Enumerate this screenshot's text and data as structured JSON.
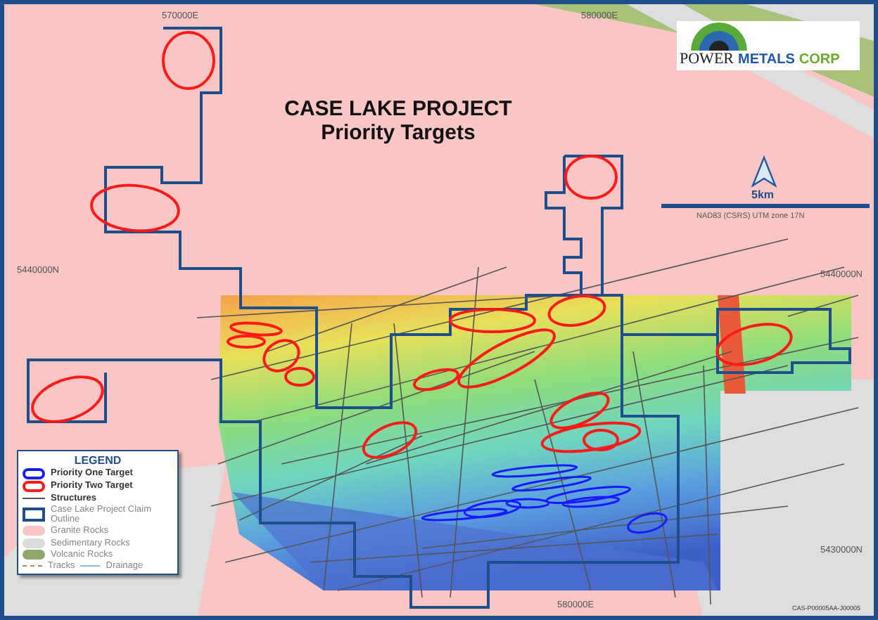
{
  "title": {
    "line1": "CASE LAKE PROJECT",
    "line2": "Priority Targets"
  },
  "logo": {
    "words": [
      {
        "text": "POWER",
        "color": "#222222"
      },
      {
        "text": "METALS",
        "color": "#1f5aa6"
      },
      {
        "text": "CORP",
        "color": "#6aab2e"
      }
    ]
  },
  "scale": {
    "label": "5km",
    "projection": "NAD83 (CSRS) UTM zone 17N"
  },
  "grid_labels": {
    "top": [
      "570000E",
      "580000E"
    ],
    "left": [
      "5440000N"
    ],
    "right": [
      "5440000N",
      "5430000N"
    ],
    "bottom": [
      "580000E"
    ]
  },
  "legend": {
    "title": "LEGEND",
    "items": [
      {
        "kind": "target",
        "label": "Priority One Target",
        "color": "#1a1aff"
      },
      {
        "kind": "target",
        "label": "Priority Two Target",
        "color": "#ff1a1a"
      },
      {
        "kind": "line",
        "label": "Structures",
        "color": "#555555"
      },
      {
        "kind": "claim",
        "label": "Case Lake Project Claim Outline",
        "color": "#1f4e8c"
      },
      {
        "kind": "fill",
        "label": "Granite Rocks",
        "color": "#f9c5c5"
      },
      {
        "kind": "fill",
        "label": "Sedimentary Rocks",
        "color": "#dcdcdc"
      },
      {
        "kind": "fill",
        "label": "Volcanic Rocks",
        "color": "#8ea86b"
      }
    ],
    "bottom_items": [
      {
        "kind": "dashed",
        "label": "Tracks",
        "color": "#b58a5a"
      },
      {
        "kind": "solid",
        "label": "Drainage",
        "color": "#8ab4f0"
      }
    ]
  },
  "footer_code": "CAS-P00005AA-J00005"
}
